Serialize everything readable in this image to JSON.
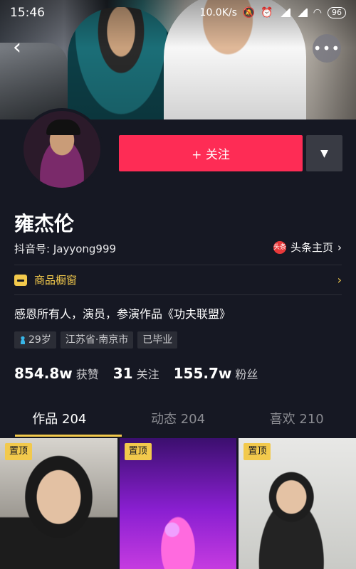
{
  "status_bar": {
    "time": "15:46",
    "speed": "10.0K/s",
    "battery": "96"
  },
  "profile": {
    "name": "雍杰伦",
    "douyin_id": "抖音号: Jayyong999",
    "toutiao_logo_text": "头条",
    "toutiao_label": "头条主页",
    "shop_label": "商品橱窗",
    "bio": "感恩所有人，演员，参演作品《功夫联盟》",
    "follow_button": "+ 关注"
  },
  "tags": [
    {
      "label": "29岁",
      "icon": "person-icon"
    },
    {
      "label": "江苏省·南京市"
    },
    {
      "label": "已毕业"
    }
  ],
  "stats": [
    {
      "value": "854.8w",
      "label": "获赞"
    },
    {
      "value": "31",
      "label": "关注"
    },
    {
      "value": "155.7w",
      "label": "粉丝"
    }
  ],
  "tabs": [
    {
      "label": "作品 204",
      "active": true
    },
    {
      "label": "动态 204",
      "active": false
    },
    {
      "label": "喜欢 210",
      "active": false
    }
  ],
  "videos": [
    {
      "pin": "置顶"
    },
    {
      "pin": "置顶"
    },
    {
      "pin": "置顶"
    }
  ],
  "colors": {
    "background": "#161823",
    "follow": "#fe2c55",
    "accent": "#f2c94c"
  }
}
